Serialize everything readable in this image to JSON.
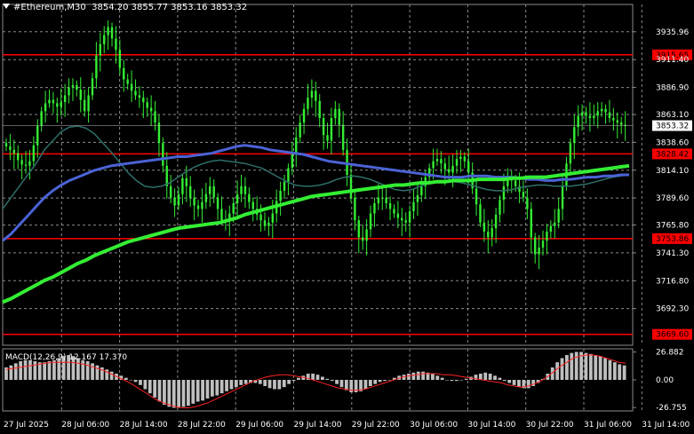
{
  "header": {
    "symbol": "#Ethereum,M30",
    "ohlc": "3854.20 3855.77 3853.16 3853.32"
  },
  "macd_label": "MACD(12,26,9) 12.167 17.370",
  "colors": {
    "background": "#000000",
    "grid": "#8a8a8a",
    "candle": "#33ee33",
    "level_line": "#ff0000",
    "ma_fast": "#2e6f6a",
    "ma_mid": "#4b63d6",
    "ma_slow": "#33ee33",
    "macd_hist": "#bfbfbf",
    "macd_signal": "#ff2222",
    "current_price_box": "#ffffff"
  },
  "chart_data": {
    "type": "candlestick",
    "price_axis": {
      "ylim": [
        3660,
        3960
      ],
      "ticks": [
        3935.96,
        3911.4,
        3886.9,
        3863.1,
        3838.6,
        3814.1,
        3789.6,
        3765.8,
        3741.3,
        3716.8,
        3692.3
      ],
      "current_price": "3853.32"
    },
    "levels": [
      {
        "label": "3915.65",
        "value": 3915.65
      },
      {
        "label": "3828.42",
        "value": 3828.42
      },
      {
        "label": "3753.86",
        "value": 3753.86
      },
      {
        "label": "3669.60",
        "value": 3669.6
      }
    ],
    "time_axis": {
      "ticks": [
        "27 Jul 2025",
        "28 Jul 06:00",
        "28 Jul 14:00",
        "28 Jul 22:00",
        "29 Jul 06:00",
        "29 Jul 14:00",
        "29 Jul 22:00",
        "30 Jul 06:00",
        "30 Jul 14:00",
        "30 Jul 22:00",
        "31 Jul 06:00",
        "31 Jul 14:00"
      ]
    },
    "price_series": [
      3835,
      3832,
      3829,
      3823,
      3819,
      3818,
      3822,
      3836,
      3853,
      3866,
      3873,
      3876,
      3873,
      3870,
      3874,
      3880,
      3887,
      3889,
      3885,
      3876,
      3866,
      3880,
      3895,
      3915,
      3925,
      3933,
      3940,
      3930,
      3920,
      3904,
      3894,
      3890,
      3884,
      3880,
      3878,
      3874,
      3869,
      3866,
      3856,
      3838,
      3818,
      3800,
      3790,
      3783,
      3793,
      3807,
      3800,
      3790,
      3783,
      3780,
      3786,
      3793,
      3800,
      3790,
      3780,
      3770,
      3770,
      3776,
      3785,
      3793,
      3800,
      3793,
      3786,
      3780,
      3775,
      3770,
      3765,
      3768,
      3776,
      3787,
      3796,
      3804,
      3816,
      3828,
      3843,
      3856,
      3868,
      3878,
      3884,
      3875,
      3860,
      3845,
      3840,
      3860,
      3868,
      3854,
      3832,
      3810,
      3790,
      3770,
      3755,
      3752,
      3762,
      3776,
      3785,
      3790,
      3790,
      3785,
      3780,
      3776,
      3772,
      3770,
      3768,
      3778,
      3786,
      3792,
      3800,
      3808,
      3816,
      3822,
      3824,
      3820,
      3815,
      3812,
      3818,
      3824,
      3826,
      3822,
      3812,
      3798,
      3784,
      3768,
      3760,
      3755,
      3763,
      3775,
      3788,
      3800,
      3807,
      3805,
      3800,
      3795,
      3790,
      3780,
      3755,
      3740,
      3746,
      3752,
      3760,
      3765,
      3768,
      3780,
      3800,
      3820,
      3838,
      3852,
      3862,
      3865,
      3862,
      3860,
      3862,
      3866,
      3868,
      3865,
      3860,
      3858,
      3856,
      3854,
      3853
    ],
    "ma_fast": [
      3780,
      3790,
      3800,
      3810,
      3820,
      3832,
      3840,
      3848,
      3852,
      3853,
      3851,
      3846,
      3838,
      3830,
      3821,
      3812,
      3805,
      3800,
      3799,
      3800,
      3803,
      3808,
      3813,
      3817,
      3820,
      3822,
      3823,
      3822,
      3821,
      3820,
      3818,
      3816,
      3812,
      3808,
      3804,
      3801,
      3800,
      3800,
      3801,
      3803,
      3806,
      3808,
      3809,
      3808,
      3806,
      3803,
      3800,
      3797,
      3796,
      3797,
      3800,
      3803,
      3805,
      3805,
      3804,
      3803,
      3801,
      3799,
      3797,
      3796,
      3796,
      3797,
      3799,
      3800,
      3801,
      3801,
      3800,
      3800,
      3800,
      3801,
      3802,
      3804,
      3806,
      3808,
      3809,
      3810
    ],
    "ma_mid": [
      3752,
      3758,
      3766,
      3774,
      3782,
      3790,
      3796,
      3801,
      3805,
      3808,
      3811,
      3814,
      3816,
      3818,
      3819,
      3820,
      3821,
      3822,
      3823,
      3824,
      3825,
      3826,
      3826,
      3827,
      3828,
      3829,
      3831,
      3833,
      3835,
      3836,
      3835,
      3834,
      3832,
      3831,
      3830,
      3829,
      3828,
      3826,
      3824,
      3822,
      3821,
      3820,
      3819,
      3818,
      3817,
      3816,
      3815,
      3814,
      3813,
      3812,
      3811,
      3810,
      3809,
      3808,
      3808,
      3808,
      3809,
      3809,
      3809,
      3808,
      3808,
      3808,
      3807,
      3806,
      3806,
      3805,
      3805,
      3806,
      3806,
      3807,
      3808,
      3808,
      3809,
      3809,
      3810,
      3810
    ],
    "ma_slow": [
      3698,
      3701,
      3705,
      3709,
      3713,
      3717,
      3720,
      3724,
      3728,
      3732,
      3735,
      3739,
      3742,
      3745,
      3748,
      3751,
      3753,
      3755,
      3757,
      3759,
      3761,
      3763,
      3764,
      3765,
      3766,
      3767,
      3768,
      3770,
      3772,
      3775,
      3777,
      3779,
      3781,
      3783,
      3785,
      3787,
      3789,
      3791,
      3792,
      3793,
      3794,
      3795,
      3796,
      3797,
      3798,
      3799,
      3800,
      3801,
      3801,
      3802,
      3803,
      3803,
      3804,
      3804,
      3805,
      3805,
      3805,
      3806,
      3806,
      3806,
      3806,
      3807,
      3807,
      3808,
      3808,
      3808,
      3809,
      3810,
      3811,
      3812,
      3813,
      3814,
      3815,
      3816,
      3817,
      3818
    ],
    "macd": {
      "ylim": [
        -30,
        30
      ],
      "ticks": [
        "26.882",
        "0.00",
        "-26.755"
      ],
      "histogram": [
        12,
        14,
        16,
        18,
        19,
        19,
        18,
        17,
        17,
        18,
        19,
        21,
        23,
        24,
        23,
        21,
        19,
        18,
        16,
        14,
        12,
        10,
        8,
        6,
        4,
        2,
        0,
        -2,
        -5,
        -9,
        -13,
        -17,
        -21,
        -24,
        -26,
        -27,
        -27,
        -26,
        -25,
        -23,
        -21,
        -20,
        -18,
        -16,
        -15,
        -13,
        -11,
        -9,
        -7,
        -5,
        -4,
        -3,
        -3,
        -4,
        -6,
        -8,
        -9,
        -9,
        -7,
        -4,
        -1,
        2,
        4,
        6,
        6,
        5,
        3,
        1,
        -1,
        -4,
        -7,
        -10,
        -12,
        -12,
        -11,
        -9,
        -6,
        -4,
        -2,
        -1,
        0,
        2,
        4,
        5,
        6,
        7,
        8,
        8,
        7,
        6,
        4,
        2,
        0,
        -1,
        -1,
        0,
        1,
        3,
        5,
        6,
        7,
        6,
        4,
        2,
        -1,
        -3,
        -5,
        -7,
        -8,
        -8,
        -6,
        -3,
        1,
        6,
        12,
        17,
        21,
        24,
        26,
        27,
        27,
        26,
        25,
        24,
        23,
        21,
        19,
        17,
        15,
        14
      ],
      "signal": [
        10,
        11,
        12,
        13,
        14,
        15,
        16,
        17,
        17,
        17,
        17,
        16,
        15,
        13,
        11,
        9,
        6,
        3,
        0,
        -3,
        -7,
        -11,
        -15,
        -19,
        -22,
        -24,
        -26,
        -27,
        -27,
        -26,
        -24,
        -22,
        -19,
        -16,
        -13,
        -10,
        -7,
        -4,
        -1,
        1,
        3,
        4,
        5,
        5,
        4,
        3,
        2,
        0,
        -2,
        -4,
        -6,
        -8,
        -9,
        -10,
        -10,
        -9,
        -7,
        -5,
        -3,
        -1,
        1,
        3,
        4,
        5,
        6,
        6,
        6,
        5,
        5,
        4,
        3,
        2,
        1,
        0,
        -1,
        -2,
        -3,
        -5,
        -6,
        -7,
        -6,
        -4,
        -1,
        3,
        8,
        13,
        17,
        21,
        23,
        24,
        24,
        23,
        21,
        19,
        17,
        16
      ]
    }
  }
}
